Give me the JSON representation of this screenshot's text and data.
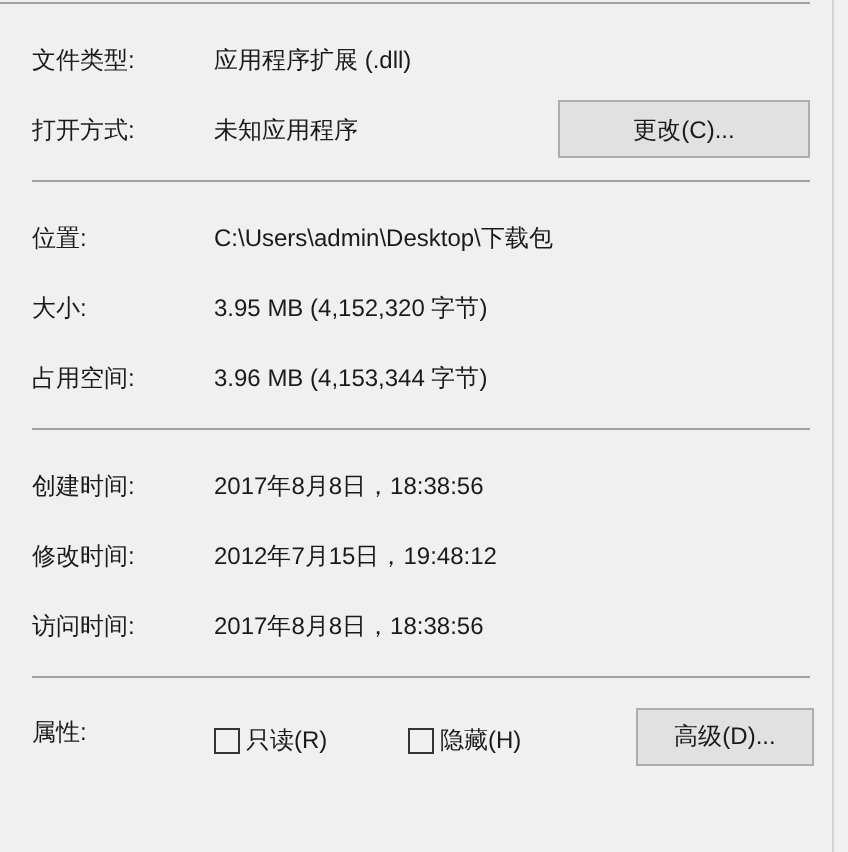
{
  "sections": [
    {
      "rows": [
        {
          "label": "文件类型:",
          "value": "应用程序扩展 (.dll)"
        },
        {
          "label": "打开方式:",
          "value": "未知应用程序",
          "button": "更改(C)..."
        }
      ]
    },
    {
      "rows": [
        {
          "label": "位置:",
          "value": "C:\\Users\\admin\\Desktop\\下载包"
        },
        {
          "label": "大小:",
          "value": "3.95 MB (4,152,320 字节)"
        },
        {
          "label": "占用空间:",
          "value": "3.96 MB (4,153,344 字节)"
        }
      ]
    },
    {
      "rows": [
        {
          "label": "创建时间:",
          "value": "2017年8月8日，18:38:56"
        },
        {
          "label": "修改时间:",
          "value": "2012年7月15日，19:48:12"
        },
        {
          "label": "访问时间:",
          "value": "2017年8月8日，18:38:56"
        }
      ]
    }
  ],
  "attributes": {
    "label": "属性:",
    "checkboxes": [
      {
        "label": "只读(R)",
        "checked": false
      },
      {
        "label": "隐藏(H)",
        "checked": false
      }
    ],
    "button": "高级(D)..."
  }
}
